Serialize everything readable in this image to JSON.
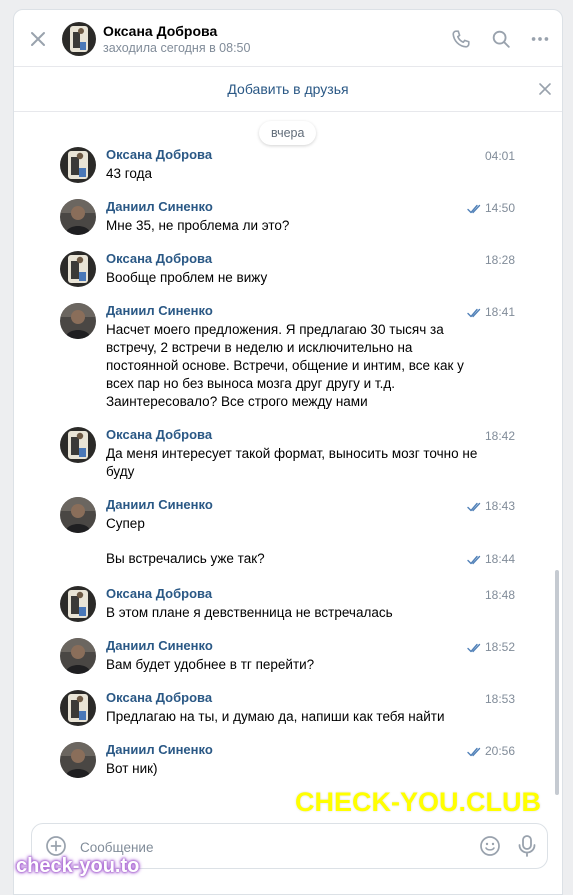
{
  "header": {
    "name": "Оксана Доброва",
    "status": "заходила сегодня в 08:50"
  },
  "add_friend_label": "Добавить в друзья",
  "date_separator": "вчера",
  "messages": [
    {
      "author": "Оксана Доброва",
      "time": "04:01",
      "text": "43 года",
      "read": false
    },
    {
      "author": "Даниил Синенко",
      "time": "14:50",
      "text": "Мне 35, не проблема ли это?",
      "read": true
    },
    {
      "author": "Оксана Доброва",
      "time": "18:28",
      "text": "Вообще проблем не вижу",
      "read": false
    },
    {
      "author": "Даниил Синенко",
      "time": "18:41",
      "text": "Насчет моего предложения. Я предлагаю 30 тысяч за встречу, 2 встречи в неделю и исключительно на постоянной основе. Встречи, общение и интим, все как у всех пар но без выноса мозга друг другу и т.д. Заинтересовало? Все строго между нами",
      "read": true
    },
    {
      "author": "Оксана Доброва",
      "time": "18:42",
      "text": "Да меня интересует такой формат, выносить мозг точно не буду",
      "read": false
    },
    {
      "author": "Даниил Синенко",
      "time": "18:43",
      "text": "Супер",
      "read": true
    },
    {
      "author": "",
      "time": "18:44",
      "text": "Вы встречались уже так?",
      "read": true
    },
    {
      "author": "Оксана Доброва",
      "time": "18:48",
      "text": "В этом плане я девственница не встречалась",
      "read": false
    },
    {
      "author": "Даниил Синенко",
      "time": "18:52",
      "text": "Вам будет удобнее в тг перейти?",
      "read": true
    },
    {
      "author": "Оксана Доброва",
      "time": "18:53",
      "text": "Предлагаю на ты, и думаю да, напиши как тебя найти",
      "read": false
    },
    {
      "author": "Даниил Синенко",
      "time": "20:56",
      "text": "Вот ник)",
      "read": true
    }
  ],
  "composer": {
    "placeholder": "Сообщение"
  },
  "watermarks": {
    "main": "CHECK-YOU.CLUB",
    "corner": "check-you.to"
  },
  "colors": {
    "link": "#2a5885",
    "muted": "#818c99",
    "tick": "#5181b8",
    "watermark": "#ffff00"
  }
}
